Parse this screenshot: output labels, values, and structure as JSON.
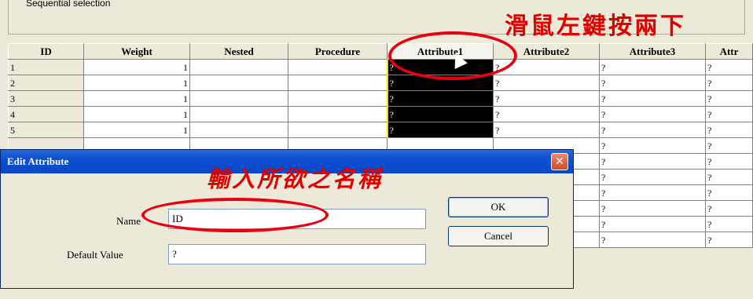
{
  "top_groupbox": {
    "label": "Sequential selection"
  },
  "annotations": {
    "double_click_hint": "滑鼠左鍵按兩下",
    "enter_name_hint": "輸入所欲之名稱"
  },
  "grid": {
    "columns": [
      "ID",
      "Weight",
      "Nested",
      "Procedure",
      "Attribute1",
      "Attribute2",
      "Attribute3",
      "Attr"
    ],
    "rows": [
      {
        "id": "1",
        "weight": "1",
        "nested": "",
        "procedure": "",
        "a1": "?",
        "a2": "?",
        "a3": "?",
        "a4": "?"
      },
      {
        "id": "2",
        "weight": "1",
        "nested": "",
        "procedure": "",
        "a1": "?",
        "a2": "?",
        "a3": "?",
        "a4": "?"
      },
      {
        "id": "3",
        "weight": "1",
        "nested": "",
        "procedure": "",
        "a1": "?",
        "a2": "?",
        "a3": "?",
        "a4": "?"
      },
      {
        "id": "4",
        "weight": "1",
        "nested": "",
        "procedure": "",
        "a1": "?",
        "a2": "?",
        "a3": "?",
        "a4": "?"
      },
      {
        "id": "5",
        "weight": "1",
        "nested": "",
        "procedure": "",
        "a1": "?",
        "a2": "?",
        "a3": "?",
        "a4": "?"
      },
      {
        "id": "",
        "weight": "",
        "nested": "",
        "procedure": "",
        "a1": "",
        "a2": "",
        "a3": "?",
        "a4": "?"
      },
      {
        "id": "",
        "weight": "",
        "nested": "",
        "procedure": "",
        "a1": "",
        "a2": "",
        "a3": "?",
        "a4": "?"
      },
      {
        "id": "",
        "weight": "",
        "nested": "",
        "procedure": "",
        "a1": "",
        "a2": "",
        "a3": "?",
        "a4": "?"
      },
      {
        "id": "",
        "weight": "",
        "nested": "",
        "procedure": "",
        "a1": "",
        "a2": "",
        "a3": "?",
        "a4": "?"
      },
      {
        "id": "",
        "weight": "",
        "nested": "",
        "procedure": "",
        "a1": "",
        "a2": "",
        "a3": "?",
        "a4": "?"
      },
      {
        "id": "",
        "weight": "",
        "nested": "",
        "procedure": "",
        "a1": "",
        "a2": "",
        "a3": "?",
        "a4": "?"
      },
      {
        "id": "",
        "weight": "",
        "nested": "",
        "procedure": "",
        "a1": "",
        "a2": "",
        "a3": "?",
        "a4": "?"
      }
    ]
  },
  "dialog": {
    "title": "Edit Attribute",
    "close_icon": "close-icon",
    "name_label": "Name",
    "name_value": "ID",
    "default_label": "Default Value",
    "default_value": "?",
    "ok_label": "OK",
    "cancel_label": "Cancel"
  },
  "colors": {
    "annotation": "#e60012",
    "titlebar": "#0b4fd0",
    "selection": "#000000"
  }
}
